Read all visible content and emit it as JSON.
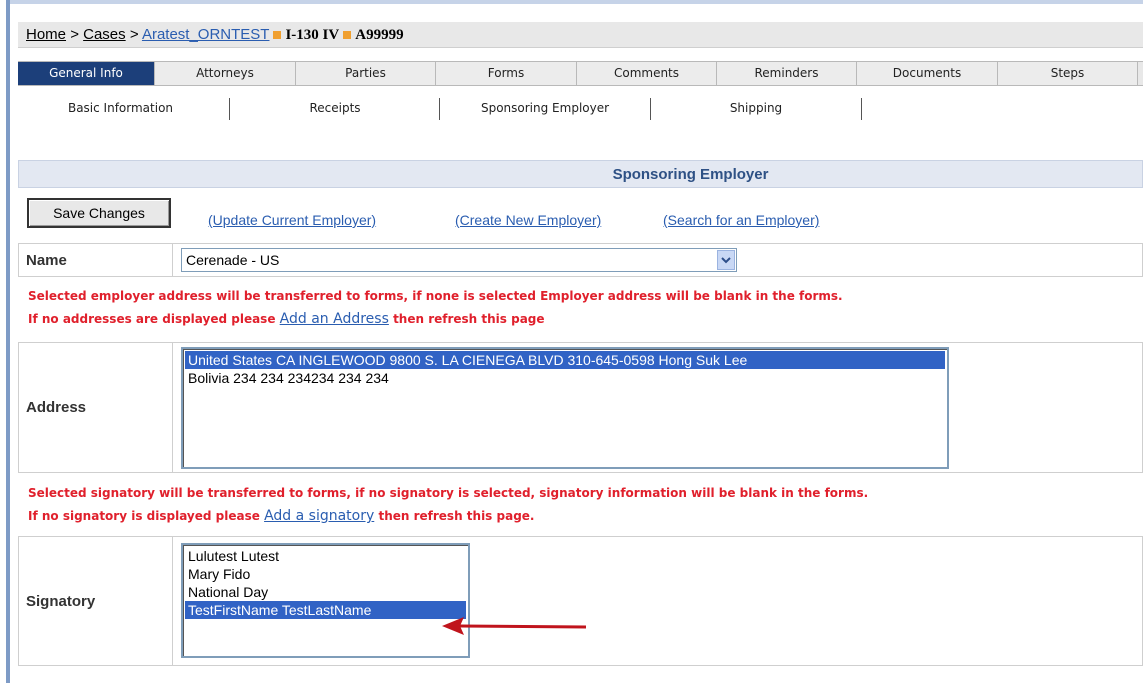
{
  "breadcrumb": {
    "home": "Home",
    "sep1": ">",
    "cases": "Cases",
    "sep2": ">",
    "client": "Aratest_ORNTEST",
    "form": "I-130 IV",
    "case_id": "A99999"
  },
  "tabs": [
    "General Info",
    "Attorneys",
    "Parties",
    "Forms",
    "Comments",
    "Reminders",
    "Documents",
    "Steps"
  ],
  "active_tab": "General Info",
  "subtabs": [
    "Basic Information",
    "Receipts",
    "Sponsoring Employer",
    "Shipping"
  ],
  "active_subtab": "Sponsoring Employer",
  "section": {
    "title": "Sponsoring Employer",
    "save_label": "Save Changes",
    "update_link": "(Update Current Employer)",
    "create_link": "(Create New Employer)",
    "search_link": "(Search for an Employer)"
  },
  "name": {
    "label": "Name",
    "selected": "Cerenade - US"
  },
  "address_notice": {
    "line1": "Selected employer address will be transferred to forms, if none is selected Employer address will be blank in the forms.",
    "line2_pre": "If no addresses are displayed please",
    "line2_link": "Add an Address",
    "line2_post": "then refresh this page"
  },
  "address": {
    "label": "Address",
    "options": [
      "United States CA INGLEWOOD 9800 S. LA CIENEGA BLVD 310-645-0598 Hong Suk Lee",
      "Bolivia 234 234 234234 234 234"
    ],
    "selected_index": 0
  },
  "signatory_notice": {
    "line1": "Selected signatory will be transferred to forms, if no signatory is selected, signatory information will be blank in the forms.",
    "line2_pre": "If no signatory is displayed please",
    "line2_link": "Add a signatory",
    "line2_post": "then refresh this page."
  },
  "signatory": {
    "label": "Signatory",
    "options": [
      "Lulutest Lutest",
      "Mary Fido",
      "National Day",
      "TestFirstName TestLastName"
    ],
    "selected_index": 3
  },
  "colors": {
    "tab_active": "#1c3f7a",
    "warning": "#e0202c",
    "link": "#2a5db0",
    "selection": "#3163c5",
    "annotation_arrow": "#c0141c"
  }
}
